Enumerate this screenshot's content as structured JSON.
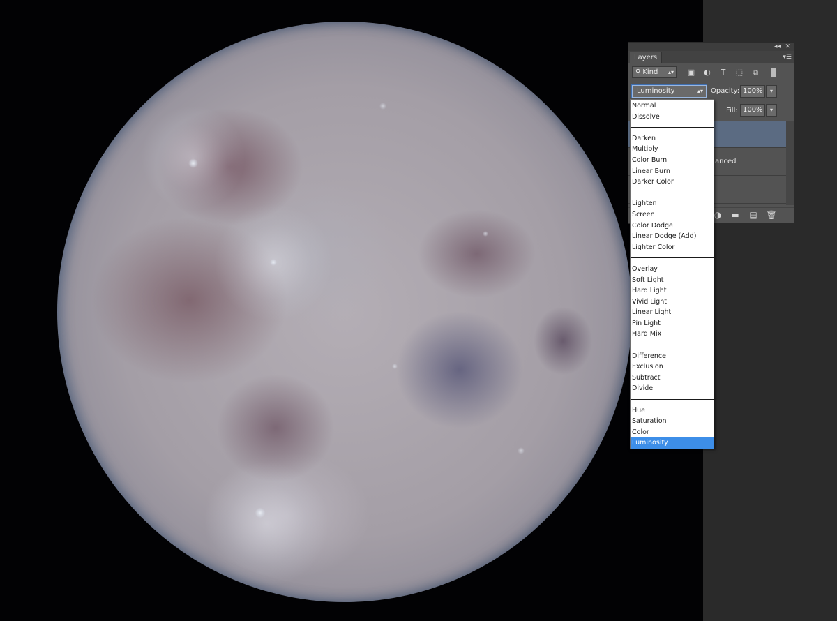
{
  "canvas": {
    "image": "moon-photo"
  },
  "panel": {
    "tab_label": "Layers",
    "collapse_glyph": "◂◂",
    "close_glyph": "✕",
    "menu_glyph": "▾☰",
    "filter": {
      "kind_label": "Kind",
      "kind_icon": "search-icon",
      "icons": [
        "image-filter-icon",
        "adjustment-filter-icon",
        "type-filter-icon",
        "shape-filter-icon",
        "smart-object-filter-icon"
      ]
    },
    "blend_mode": "Luminosity",
    "opacity_label": "Opacity:",
    "opacity_value": "100%",
    "fill_label": "Fill:",
    "fill_value": "100%",
    "layers": {
      "row2_label": "anced"
    },
    "footer_icons": [
      "adjustment-layer-icon",
      "group-folder-icon",
      "new-layer-icon",
      "trash-icon"
    ]
  },
  "blend_menu": {
    "groups": [
      [
        "Normal",
        "Dissolve"
      ],
      [
        "Darken",
        "Multiply",
        "Color Burn",
        "Linear Burn",
        "Darker Color"
      ],
      [
        "Lighten",
        "Screen",
        "Color Dodge",
        "Linear Dodge (Add)",
        "Lighter Color"
      ],
      [
        "Overlay",
        "Soft Light",
        "Hard Light",
        "Vivid Light",
        "Linear Light",
        "Pin Light",
        "Hard Mix"
      ],
      [
        "Difference",
        "Exclusion",
        "Subtract",
        "Divide"
      ],
      [
        "Hue",
        "Saturation",
        "Color",
        "Luminosity"
      ]
    ],
    "selected": "Luminosity"
  },
  "colors": {
    "panel_bg": "#535353",
    "selected_highlight": "#3d8ee8",
    "selected_layer": "#5b6b82"
  }
}
